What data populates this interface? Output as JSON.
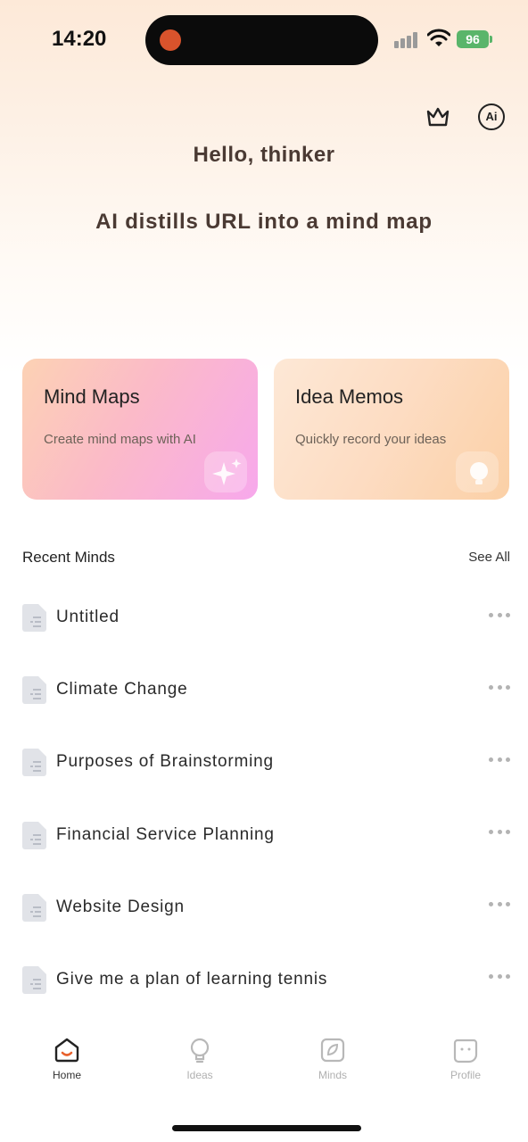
{
  "status_bar": {
    "time": "14:20",
    "battery": "96"
  },
  "header": {
    "greeting": "Hello, thinker",
    "tagline": "AI distills URL into a mind map",
    "ai_label": "Ai"
  },
  "cards": [
    {
      "title": "Mind Maps",
      "subtitle": "Create mind maps with AI"
    },
    {
      "title": "Idea Memos",
      "subtitle": "Quickly record your ideas"
    }
  ],
  "recent": {
    "title": "Recent Minds",
    "see_all": "See All",
    "items": [
      {
        "title": "Untitled"
      },
      {
        "title": "Climate Change"
      },
      {
        "title": "Purposes of Brainstorming"
      },
      {
        "title": "Financial Service Planning"
      },
      {
        "title": "Website Design"
      },
      {
        "title": "Give me a plan of learning tennis"
      }
    ]
  },
  "tabs": [
    {
      "label": "Home",
      "icon": "home-icon",
      "active": true
    },
    {
      "label": "Ideas",
      "icon": "lightbulb-icon",
      "active": false
    },
    {
      "label": "Minds",
      "icon": "leaf-icon",
      "active": false
    },
    {
      "label": "Profile",
      "icon": "profile-icon",
      "active": false
    }
  ],
  "colors": {
    "accent_yellow": "#fdd20a",
    "home_accent": "#e8612c",
    "battery": "#5ab56a"
  }
}
